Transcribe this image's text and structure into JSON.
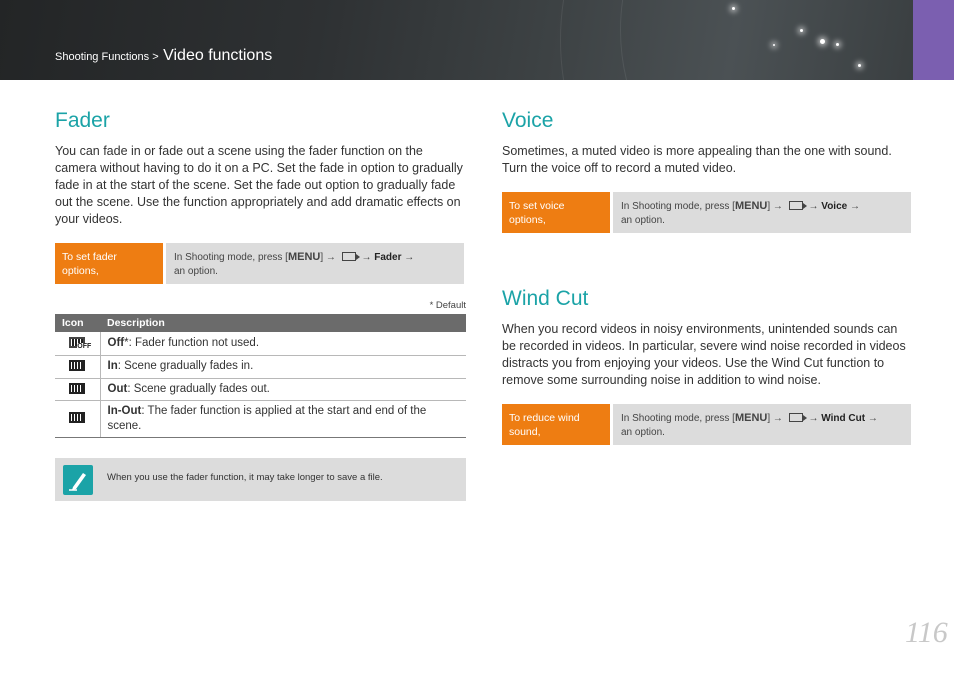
{
  "header": {
    "breadcrumb_parent": "Shooting Functions >",
    "breadcrumb_current": "Video functions",
    "accent_color": "#7b5fb0"
  },
  "fader": {
    "title": "Fader",
    "description": "You can fade in or fade out a scene using the fader function on the camera without having to do it on a PC. Set the fade in option to gradually fade in at the start of the scene. Set the fade out option to gradually fade out the scene. Use the function appropriately and add dramatic effects on your videos.",
    "step_label": "To set fader options,",
    "step_prefix": "In Shooting mode, press [",
    "menu_key": "MENU",
    "step_mid": "] →",
    "step_arrow": "→",
    "step_target": "Fader",
    "step_suffix": "→",
    "step_end": "an option.",
    "default_note": "* Default",
    "table": {
      "headers": [
        "Icon",
        "Description"
      ],
      "rows": [
        {
          "icon": "fader-off-icon",
          "term": "Off",
          "star": "*",
          "text": ": Fader function not used."
        },
        {
          "icon": "fader-in-icon",
          "term": "In",
          "star": "",
          "text": ": Scene gradually fades in."
        },
        {
          "icon": "fader-out-icon",
          "term": "Out",
          "star": "",
          "text": ": Scene gradually fades out."
        },
        {
          "icon": "fader-in-out-icon",
          "term": "In-Out",
          "star": "",
          "text": ": The fader function is applied at the start and end of the scene."
        }
      ]
    },
    "note": "When you use the fader function, it may take longer to save a file."
  },
  "voice": {
    "title": "Voice",
    "description": "Sometimes, a muted video is more appealing than the one with sound. Turn the voice off to record a muted video.",
    "step_label": "To set voice options,",
    "step_prefix": "In Shooting mode, press [",
    "menu_key": "MENU",
    "step_mid": "] →",
    "step_arrow": "→",
    "step_target": "Voice",
    "step_suffix": "→",
    "step_end": "an option."
  },
  "wind_cut": {
    "title": "Wind Cut",
    "description": "When you record videos in noisy environments, unintended sounds can be recorded in videos. In particular, severe wind noise recorded in videos distracts you from enjoying your videos. Use the Wind Cut function to remove some surrounding noise in addition to wind noise.",
    "step_label": "To reduce wind sound,",
    "step_prefix": "In Shooting mode, press [",
    "menu_key": "MENU",
    "step_mid": "] →",
    "step_arrow": "→",
    "step_target": "Wind Cut",
    "step_suffix": "→",
    "step_end": "an option."
  },
  "colors": {
    "title_teal": "#1ba3a7",
    "step_orange": "#ee7d12",
    "step_gray": "#dcdcdc"
  },
  "page_number": "116"
}
